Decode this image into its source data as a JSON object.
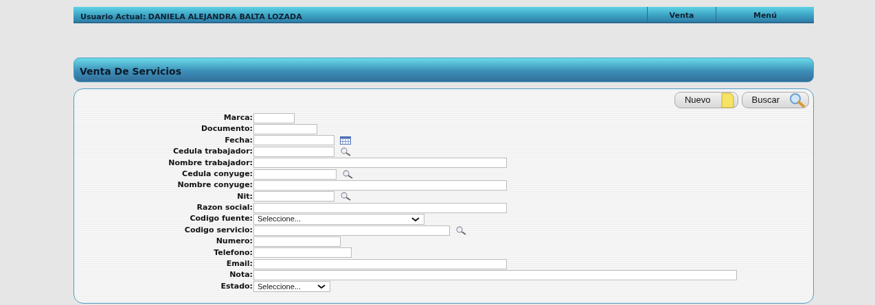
{
  "top_bar": {
    "user": "Usuario Actual: DANIELA ALEJANDRA BALTA LOZADA",
    "menu": [
      "Venta",
      "Menú"
    ]
  },
  "header": {
    "title": "Venta De Servicios"
  },
  "buttons": [
    {
      "label": "Nuevo",
      "kind": "new"
    },
    {
      "label": "Buscar",
      "kind": "search"
    }
  ],
  "fields": [
    {
      "label": "Marca:",
      "kind": "text"
    },
    {
      "label": "Documento:",
      "kind": "text"
    },
    {
      "label": "Fecha:",
      "kind": "date"
    },
    {
      "label": "Cedula trabajador:",
      "kind": "lookup"
    },
    {
      "label": "Nombre trabajador:",
      "kind": "text"
    },
    {
      "label": "Cedula conyuge:",
      "kind": "lookup"
    },
    {
      "label": "Nombre conyuge:",
      "kind": "text"
    },
    {
      "label": "Nit:",
      "kind": "lookup"
    },
    {
      "label": "Razon social:",
      "kind": "text"
    },
    {
      "label": "Codigo fuente:",
      "kind": "select",
      "value": "Seleccione..."
    },
    {
      "label": "Codigo servicio:",
      "kind": "lookup"
    },
    {
      "label": "Numero:",
      "kind": "text"
    },
    {
      "label": "Telefono:",
      "kind": "text"
    },
    {
      "label": "Email:",
      "kind": "text"
    },
    {
      "label": "Nota:",
      "kind": "text"
    },
    {
      "label": "Estado:",
      "kind": "select",
      "value": "Seleccione..."
    }
  ]
}
